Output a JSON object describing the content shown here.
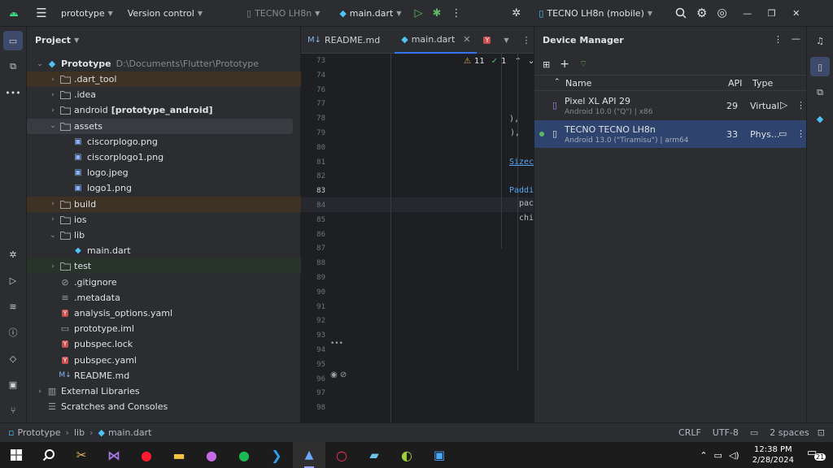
{
  "topbar": {
    "project_name": "prototype",
    "vcs_label": "Version control",
    "device_selector_muted": "TECNO LH8n",
    "run_config": "main.dart",
    "device_selector": "TECNO LH8n (mobile)"
  },
  "project_panel": {
    "title": "Project",
    "root_name": "Prototype",
    "root_path": "D:\\Documents\\Flutter\\Prototype",
    "items": [
      {
        "label": ".dart_tool"
      },
      {
        "label": ".idea"
      },
      {
        "label": "android",
        "suffix": "[prototype_android]"
      },
      {
        "label": "assets"
      },
      {
        "label": "ciscorplogo.png"
      },
      {
        "label": "ciscorplogo1.png"
      },
      {
        "label": "logo.jpeg"
      },
      {
        "label": "logo1.png"
      },
      {
        "label": "build"
      },
      {
        "label": "ios"
      },
      {
        "label": "lib"
      },
      {
        "label": "main.dart"
      },
      {
        "label": "test"
      },
      {
        "label": ".gitignore"
      },
      {
        "label": ".metadata"
      },
      {
        "label": "analysis_options.yaml"
      },
      {
        "label": "prototype.iml"
      },
      {
        "label": "pubspec.lock"
      },
      {
        "label": "pubspec.yaml"
      },
      {
        "label": "README.md"
      },
      {
        "label": "External Libraries"
      },
      {
        "label": "Scratches and Consoles"
      }
    ]
  },
  "editor": {
    "tabs": [
      {
        "label": "README.md",
        "prefix": "M↓"
      },
      {
        "label": "main.dart"
      }
    ],
    "warnings": "11",
    "checks": "1",
    "line_numbers": [
      "73",
      "74",
      "76",
      "77",
      "78",
      "79",
      "80",
      "81",
      "82",
      "83",
      "84",
      "85",
      "86",
      "87",
      "88",
      "89",
      "90",
      "91",
      "92",
      "93",
      "94",
      "95",
      "96",
      "97",
      "98"
    ],
    "code_fragments": [
      "),",
      "),",
      "Sizec",
      "Paddi",
      "pac",
      "chi"
    ]
  },
  "device_manager": {
    "title": "Device Manager",
    "columns": {
      "name": "Name",
      "api": "API",
      "type": "Type"
    },
    "devices": [
      {
        "name": "Pixel XL API 29",
        "details": "Android 10.0 (\"Q\") | x86",
        "api": "29",
        "type": "Virtual"
      },
      {
        "name": "TECNO TECNO LH8n",
        "details": "Android 13.0 (\"Tiramisu\") | arm64",
        "api": "33",
        "type": "Phys..."
      }
    ]
  },
  "statusbar": {
    "breadcrumb": [
      "Prototype",
      "lib",
      "main.dart"
    ],
    "line_sep": "CRLF",
    "encoding": "UTF-8",
    "indent": "2 spaces"
  },
  "taskbar": {
    "time": "12:38 PM",
    "date": "2/28/2024",
    "notifications": "21"
  }
}
